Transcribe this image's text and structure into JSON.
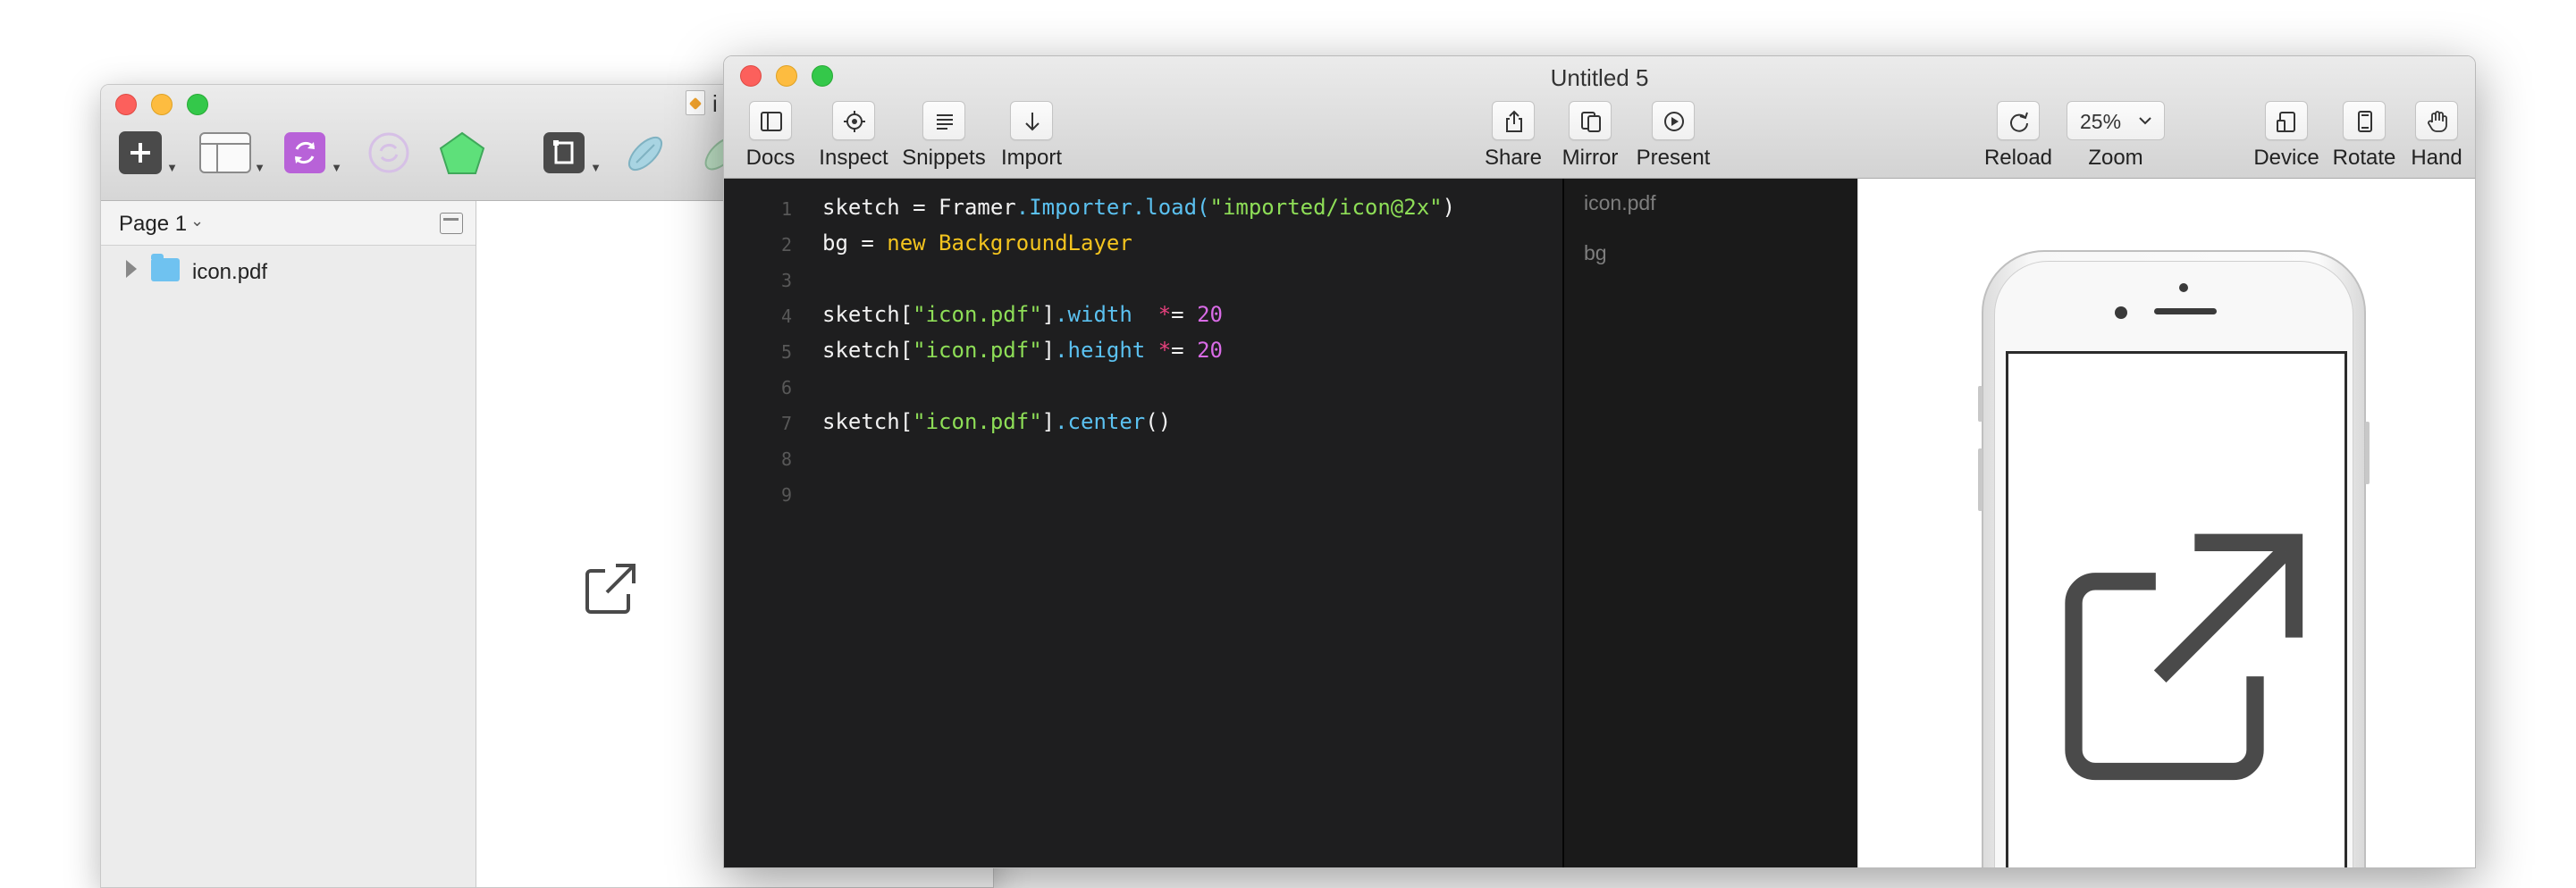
{
  "sketch_window": {
    "title": "i",
    "toolbar": [
      "insert-tool",
      "layout-tool",
      "symbol-tool",
      "sync-tool",
      "shape-tool",
      "artboard-tool",
      "link-tool"
    ],
    "sidebar": {
      "page_label": "Page 1",
      "layers": [
        {
          "name": "icon.pdf",
          "type": "folder"
        }
      ]
    },
    "canvas_icon": "external-link-icon"
  },
  "framer_window": {
    "title": "Untitled 5",
    "toolbar": {
      "docs": "Docs",
      "inspect": "Inspect",
      "snippets": "Snippets",
      "import": "Import",
      "share": "Share",
      "mirror": "Mirror",
      "present": "Present",
      "reload": "Reload",
      "zoom_label": "Zoom",
      "zoom_value": "25%",
      "device": "Device",
      "rotate": "Rotate",
      "hand": "Hand"
    },
    "editor": {
      "line_numbers": [
        "1",
        "2",
        "3",
        "4",
        "5",
        "6",
        "7",
        "8",
        "9"
      ],
      "lines": [
        "sketch = Framer.Importer.load(\"imported/icon@2x\")",
        "bg = new BackgroundLayer",
        "",
        "sketch[\"icon.pdf\"].width  *= 20",
        "sketch[\"icon.pdf\"].height *= 20",
        "",
        "sketch[\"icon.pdf\"].center()",
        "",
        ""
      ],
      "tokens": {
        "l1_a": "sketch = Framer",
        "l1_b": ".Importer.load(",
        "l1_c": "\"imported/icon@2x\"",
        "l1_d": ")",
        "l2_a": "bg = ",
        "l2_b": "new BackgroundLayer",
        "l4_a": "sketch[",
        "l4_b": "\"icon.pdf\"",
        "l4_c": "]",
        "l4_d": ".width  ",
        "l4_e": "*",
        "l4_f": "= ",
        "l4_g": "20",
        "l5_a": "sketch[",
        "l5_b": "\"icon.pdf\"",
        "l5_c": "]",
        "l5_d": ".height ",
        "l5_e": "*",
        "l5_f": "= ",
        "l5_g": "20",
        "l7_a": "sketch[",
        "l7_b": "\"icon.pdf\"",
        "l7_c": "]",
        "l7_d": ".center",
        "l7_e": "()"
      }
    },
    "layers_panel": [
      "icon.pdf",
      "bg"
    ],
    "preview": {
      "device": "iPhone (white)",
      "content_icon": "external-link-icon"
    }
  },
  "colors": {
    "editor_bg": "#1e1e1f",
    "code_blue": "#5bc1f0",
    "code_green": "#8ede57",
    "code_yellow": "#f3c41e",
    "code_purple": "#d96be6",
    "code_pink": "#e8417e"
  }
}
